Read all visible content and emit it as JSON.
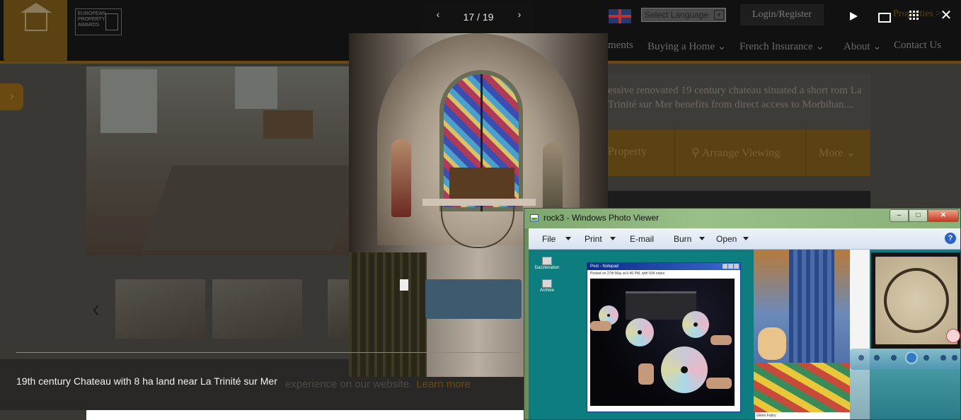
{
  "website": {
    "logo_text": "",
    "award_text": "EUROPEAN PROPERTY AWARDS",
    "language_select": "Select Language",
    "login_label": "Login/Register",
    "properties_link": "Properties >",
    "nav": [
      "ments",
      "Buying a Home",
      "French Insurance",
      "About",
      "Contact Us"
    ],
    "description": "essive renovated 19 century chateau situated a short rom La Trinité sur Mer benefits from direct access to Morbihan....",
    "actions": [
      "Property",
      "Arrange Viewing",
      "More"
    ],
    "cookie_text": "experience on our website.",
    "cookie_link": "Learn more"
  },
  "lightbox": {
    "counter": "17 / 19",
    "prev_icon": "chevron-left-icon",
    "next_icon": "chevron-right-icon",
    "caption": "19th century Chateau with 8 ha land near La Trinité sur Mer",
    "controls": [
      "play-icon",
      "fullscreen-frame-icon",
      "grid-icon",
      "close-icon"
    ]
  },
  "photo_viewer": {
    "title": "rock3 - Windows Photo Viewer",
    "window_buttons": {
      "minimize": "–",
      "maximize": "□",
      "close": "✕"
    },
    "menu": {
      "file": "File",
      "print": "Print",
      "email": "E-mail",
      "burn": "Burn",
      "open": "Open",
      "help": "?"
    },
    "desktop_icons": [
      "Dazzlenation",
      "Archive"
    ],
    "notepad_title": "Post - Notepad",
    "notepad_posted": "Posted on 27th May at 6:46 PM, with 504 notes",
    "comic_credit": "Glenn Fabry"
  },
  "colors": {
    "gold": "#6b4a12",
    "wpv_titlebar": "#8ab07a",
    "desktop_teal": "#0d7d7f"
  }
}
